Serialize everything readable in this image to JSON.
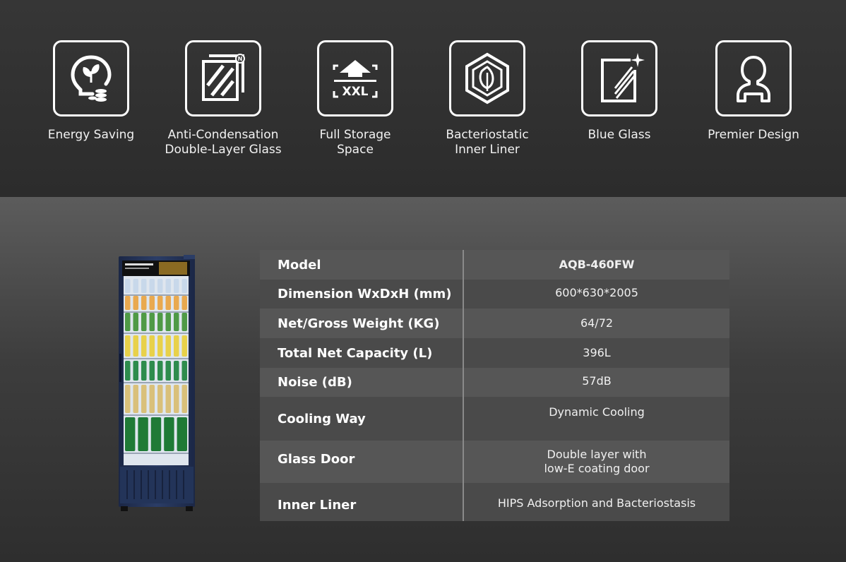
{
  "features": [
    {
      "icon": "energy-saving-bulb-icon",
      "label": "Energy Saving"
    },
    {
      "icon": "double-layer-glass-icon",
      "label": "Anti-Condensation\nDouble-Layer Glass"
    },
    {
      "icon": "xxl-storage-icon",
      "label": "Full Storage\nSpace",
      "icon_text": "XXL"
    },
    {
      "icon": "bacteriostatic-leaf-icon",
      "label": "Bacteriostatic\nInner Liner"
    },
    {
      "icon": "blue-glass-icon",
      "label": "Blue Glass"
    },
    {
      "icon": "premier-design-person-icon",
      "label": "Premier Design"
    }
  ],
  "specs": [
    {
      "label": "Model",
      "value": "AQB-460FW"
    },
    {
      "label": "Dimension WxDxH (mm)",
      "value": "600*630*2005"
    },
    {
      "label": "Net/Gross Weight (KG)",
      "value": "64/72"
    },
    {
      "label": "Total Net Capacity (L)",
      "value": "396L"
    },
    {
      "label": "Noise (dB)",
      "value": "57dB"
    },
    {
      "label": "Cooling Way",
      "value": "Dynamic Cooling"
    },
    {
      "label": "Glass Door",
      "value": "Double layer with",
      "value_line2": "low-E coating door"
    },
    {
      "label": "Inner Liner",
      "value": "HIPS Adsorption and Bacteriostasis"
    }
  ],
  "colors": {
    "background_top": "#363636",
    "table_row_light": "#565656",
    "table_row_dark": "#4a4a4a",
    "fridge_body": "#24345a"
  }
}
